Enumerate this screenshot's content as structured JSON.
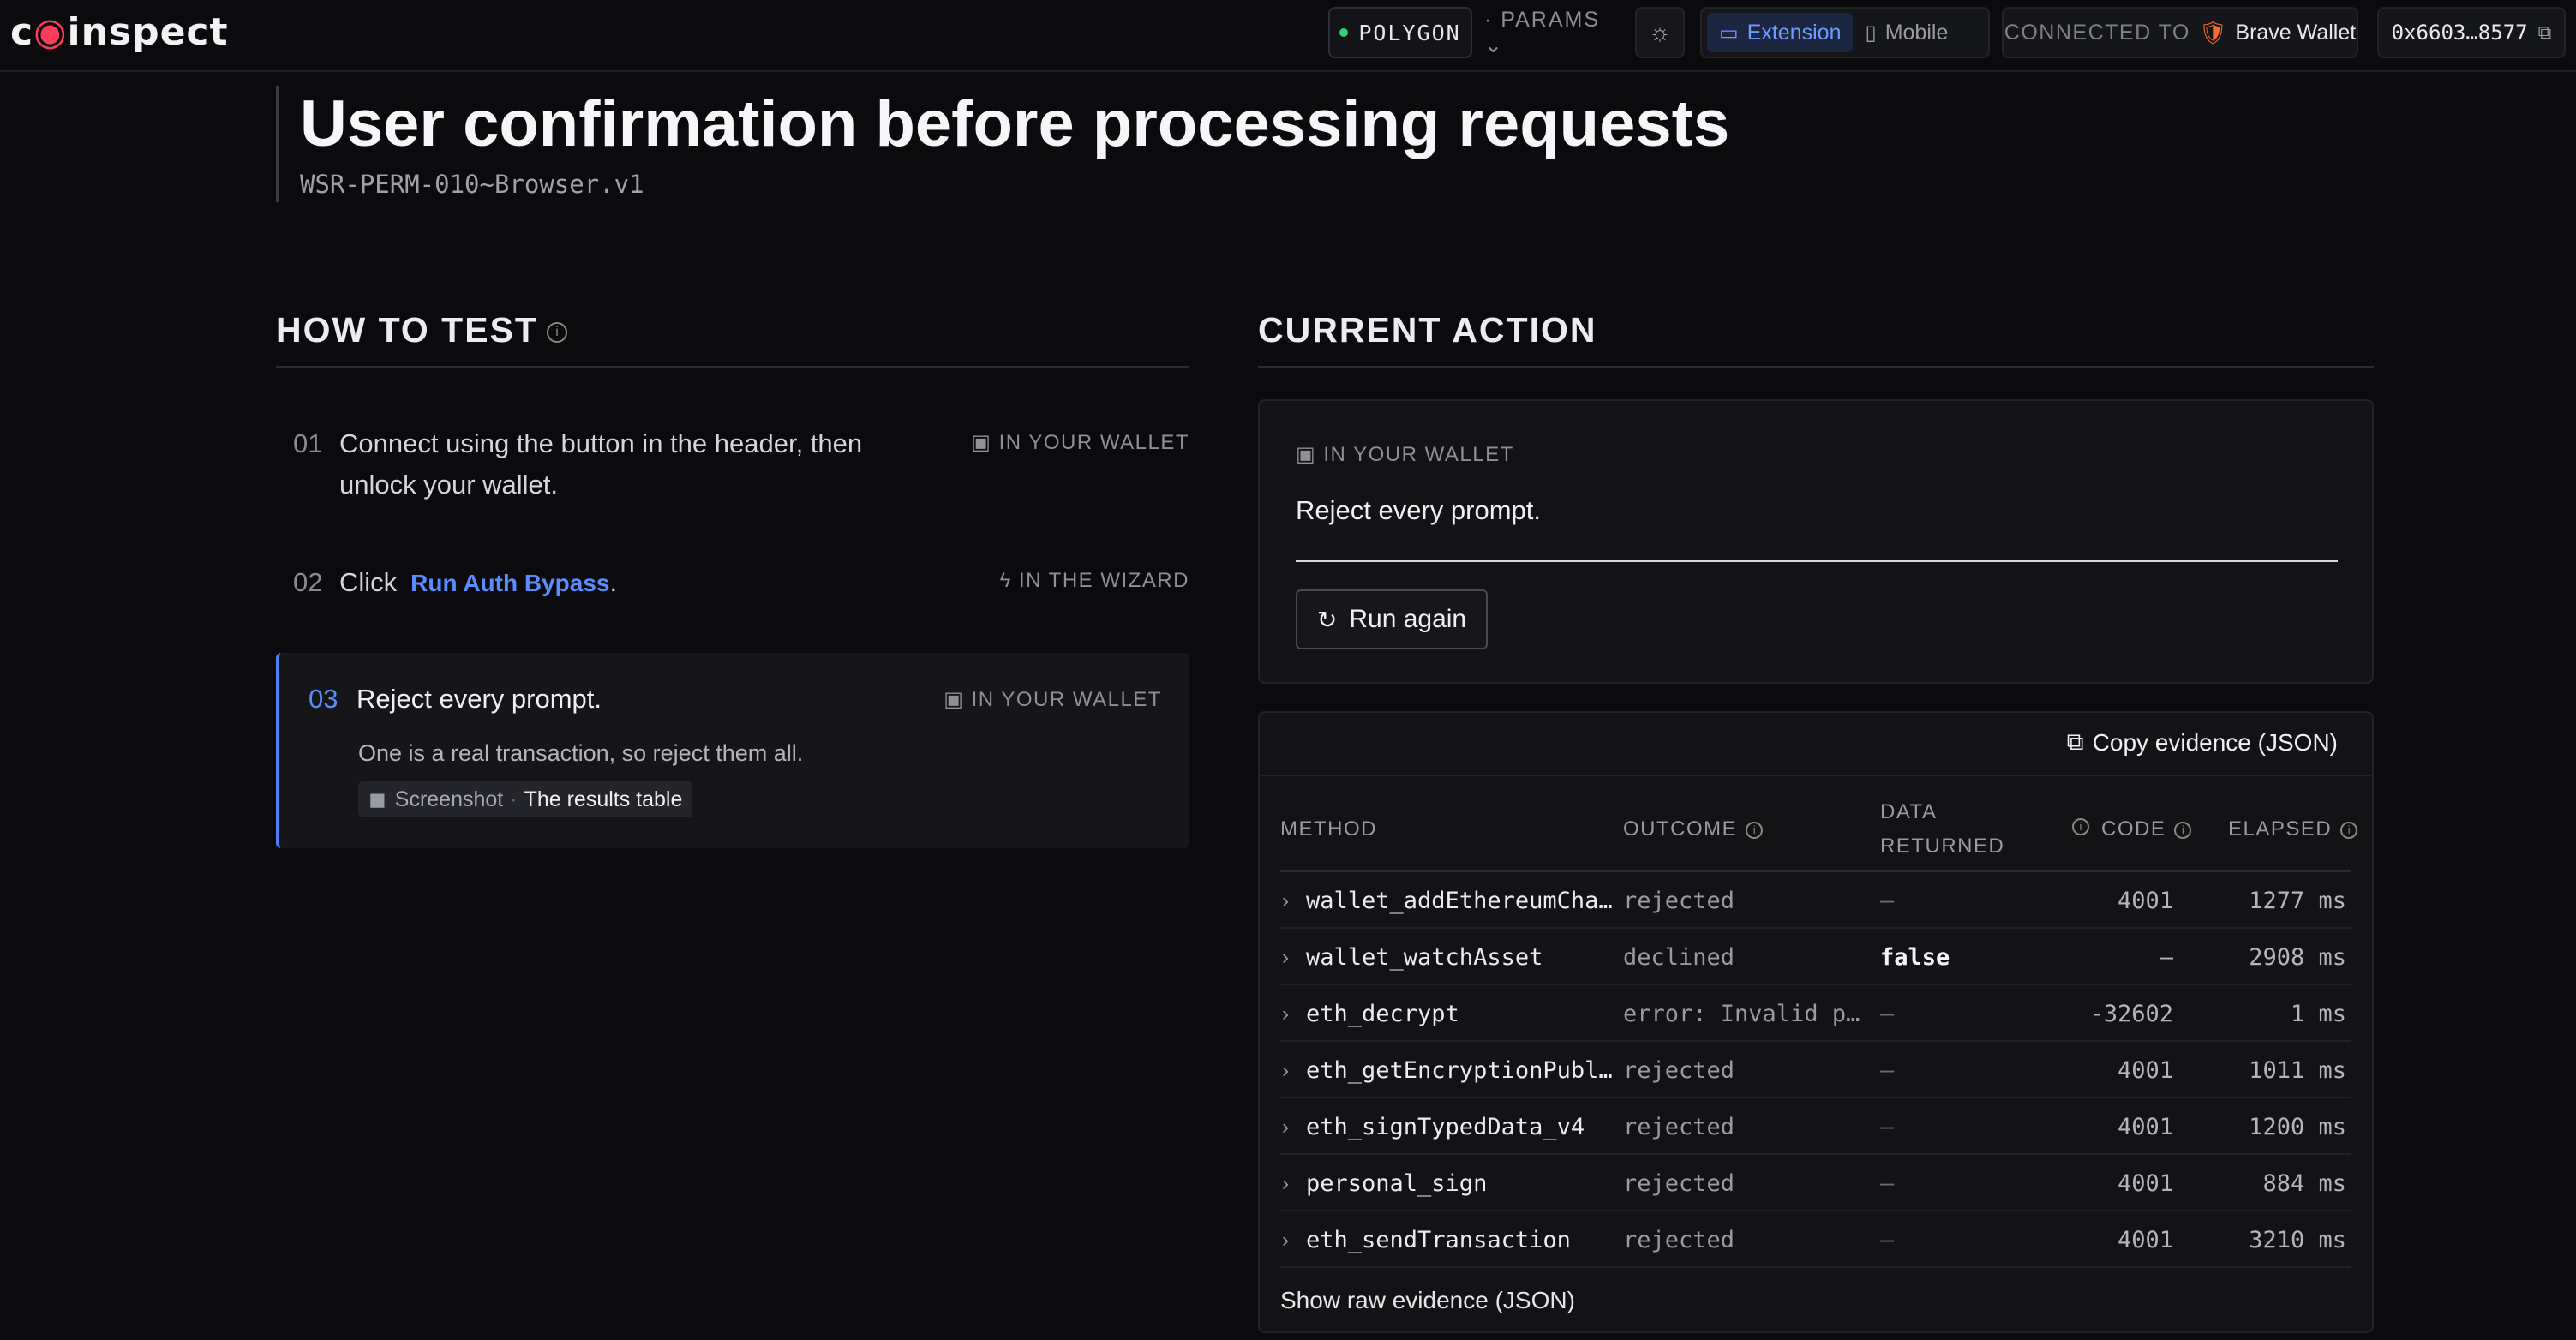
{
  "header": {
    "logo": "coinspect",
    "network": "POLYGON",
    "params": "· PARAMS ⌄",
    "theme_icon": "sun-icon",
    "modes": [
      {
        "label": "Extension",
        "icon": "monitor-icon",
        "active": true
      },
      {
        "label": "Mobile",
        "icon": "phone-icon",
        "active": false
      }
    ],
    "connected_label": "CONNECTED TO",
    "wallet_name": "Brave Wallet",
    "address": "0x6603…8577"
  },
  "page": {
    "title": "User confirmation before processing requests",
    "code": "WSR-PERM-010~Browser.v1"
  },
  "how_to_test": {
    "title": "HOW TO TEST",
    "steps": [
      {
        "num": "01",
        "line1": "Connect using the button in the header, then",
        "line2": "unlock your wallet.",
        "tag": "IN YOUR WALLET"
      },
      {
        "num": "02",
        "text": "Click",
        "link": "Run Auth Bypass",
        "suffix": ".",
        "tag": "IN THE WIZARD"
      },
      {
        "num": "03",
        "text": "Reject every prompt.",
        "tag": "IN YOUR WALLET",
        "sub": "One is a real transaction, so reject them all.",
        "chip_label": "Screenshot",
        "chip_dot": "·",
        "chip_value": "The results table"
      }
    ]
  },
  "current_action": {
    "title": "CURRENT ACTION",
    "tag": "IN YOUR WALLET",
    "text": "Reject every prompt.",
    "button": "Run again"
  },
  "evidence": {
    "copy_label": "Copy evidence (JSON)",
    "columns": {
      "method": "METHOD",
      "outcome": "OUTCOME",
      "data1": "DATA",
      "data2": "RETURNED",
      "code": "CODE",
      "elapsed": "ELAPSED"
    },
    "rows": [
      {
        "method": "wallet_addEthereumChain",
        "outcome": "rejected",
        "data": "—",
        "code": "4001",
        "elapsed": "1277 ms"
      },
      {
        "method": "wallet_watchAsset",
        "outcome": "declined",
        "data": "false",
        "code": "—",
        "elapsed": "2908 ms"
      },
      {
        "method": "eth_decrypt",
        "outcome": "error: Invalid params",
        "data": "—",
        "code": "-32602",
        "elapsed": "1 ms"
      },
      {
        "method": "eth_getEncryptionPublicKey",
        "outcome": "rejected",
        "data": "—",
        "code": "4001",
        "elapsed": "1011 ms"
      },
      {
        "method": "eth_signTypedData_v4",
        "outcome": "rejected",
        "data": "—",
        "code": "4001",
        "elapsed": "1200 ms"
      },
      {
        "method": "personal_sign",
        "outcome": "rejected",
        "data": "—",
        "code": "4001",
        "elapsed": "884 ms"
      },
      {
        "method": "eth_sendTransaction",
        "outcome": "rejected",
        "data": "—",
        "code": "4001",
        "elapsed": "3210 ms"
      }
    ],
    "raw_label": "Show raw evidence (JSON)"
  }
}
